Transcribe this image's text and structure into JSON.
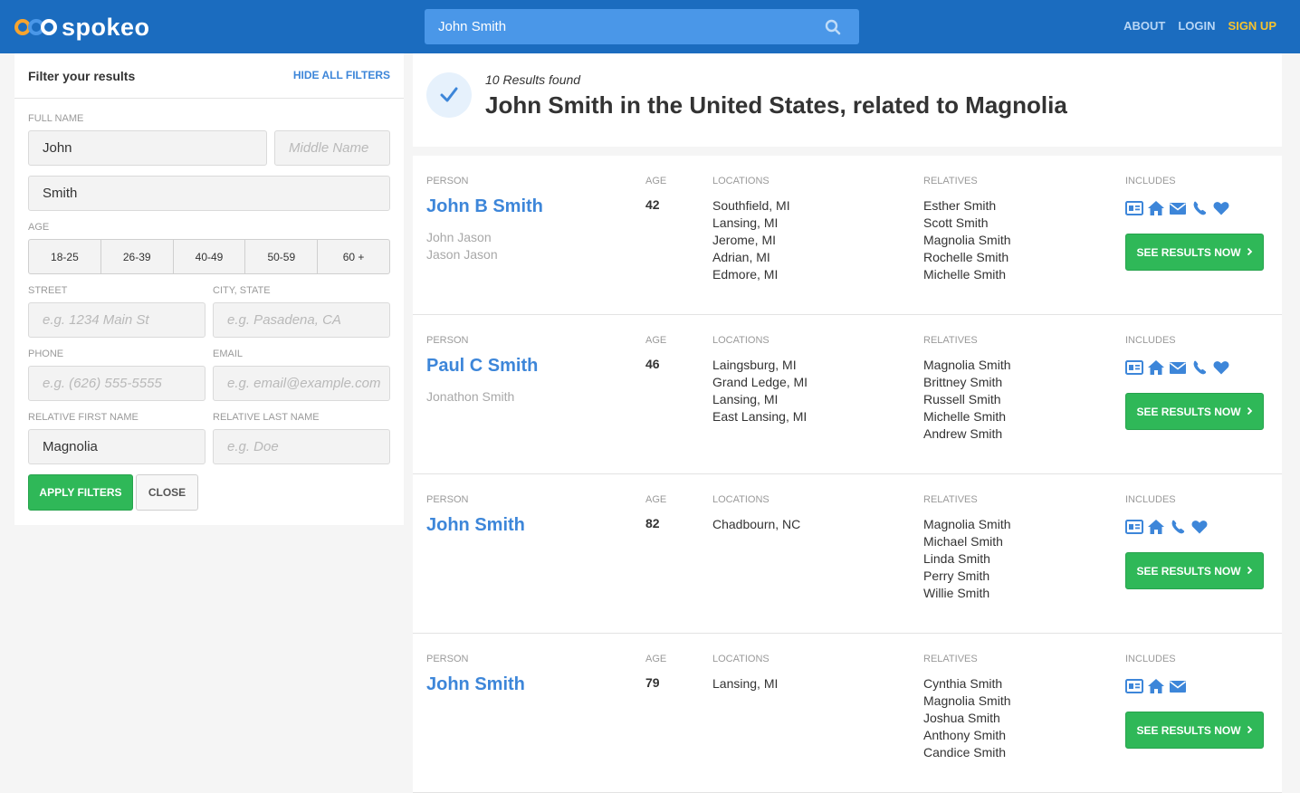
{
  "header": {
    "brand": "spokeo",
    "search_value": "John Smith",
    "nav": {
      "about": "ABOUT",
      "login": "LOGIN",
      "signup": "SIGN UP"
    }
  },
  "colors": {
    "header_bg": "#1b6cbf",
    "accent_blue": "#3d86d9",
    "green": "#2fb858",
    "signup": "#f7c32e"
  },
  "sidebar": {
    "title": "Filter your results",
    "hide_all": "HIDE ALL FILTERS",
    "full_name_label": "FULL NAME",
    "first_name": "John",
    "middle_placeholder": "Middle Name",
    "last_name": "Smith",
    "age_label": "AGE",
    "age_options": [
      "18-25",
      "26-39",
      "40-49",
      "50-59",
      "60 +"
    ],
    "street_label": "STREET",
    "street_placeholder": "e.g. 1234 Main St",
    "city_label": "CITY, STATE",
    "city_placeholder": "e.g. Pasadena, CA",
    "phone_label": "PHONE",
    "phone_placeholder": "e.g. (626) 555-5555",
    "email_label": "EMAIL",
    "email_placeholder": "e.g. email@example.com",
    "rel_first_label": "RELATIVE FIRST NAME",
    "rel_first_value": "Magnolia",
    "rel_last_label": "RELATIVE LAST NAME",
    "rel_last_placeholder": "e.g. Doe",
    "apply": "APPLY FILTERS",
    "close": "CLOSE"
  },
  "results": {
    "count": "10 Results found",
    "title": "John Smith in the United States, related to Magnolia",
    "labels": {
      "person": "PERSON",
      "age": "AGE",
      "locations": "LOCATIONS",
      "relatives": "RELATIVES",
      "includes": "INCLUDES"
    },
    "button": "SEE RESULTS NOW",
    "items": [
      {
        "name": "John B Smith",
        "aliases": [
          "John Jason",
          "Jason Jason"
        ],
        "age": "42",
        "locations": [
          "Southfield, MI",
          "Lansing, MI",
          "Jerome, MI",
          "Adrian, MI",
          "Edmore, MI"
        ],
        "relatives": [
          "Esther Smith",
          "Scott Smith",
          "Magnolia Smith",
          "Rochelle Smith",
          "Michelle Smith"
        ],
        "includes": [
          "id-card-icon",
          "home-icon",
          "mail-icon",
          "phone-icon",
          "heart-icon"
        ]
      },
      {
        "name": "Paul C Smith",
        "aliases": [
          "Jonathon Smith"
        ],
        "age": "46",
        "locations": [
          "Laingsburg, MI",
          "Grand Ledge, MI",
          "Lansing, MI",
          "East Lansing, MI"
        ],
        "relatives": [
          "Magnolia Smith",
          "Brittney Smith",
          "Russell Smith",
          "Michelle Smith",
          "Andrew Smith"
        ],
        "includes": [
          "id-card-icon",
          "home-icon",
          "mail-icon",
          "phone-icon",
          "heart-icon"
        ]
      },
      {
        "name": "John Smith",
        "aliases": [],
        "age": "82",
        "locations": [
          "Chadbourn, NC"
        ],
        "relatives": [
          "Magnolia Smith",
          "Michael Smith",
          "Linda Smith",
          "Perry Smith",
          "Willie Smith"
        ],
        "includes": [
          "id-card-icon",
          "home-icon",
          "phone-icon",
          "heart-icon"
        ]
      },
      {
        "name": "John Smith",
        "aliases": [],
        "age": "79",
        "locations": [
          "Lansing, MI"
        ],
        "relatives": [
          "Cynthia Smith",
          "Magnolia Smith",
          "Joshua Smith",
          "Anthony Smith",
          "Candice Smith"
        ],
        "includes": [
          "id-card-icon",
          "home-icon",
          "mail-icon"
        ]
      }
    ]
  }
}
